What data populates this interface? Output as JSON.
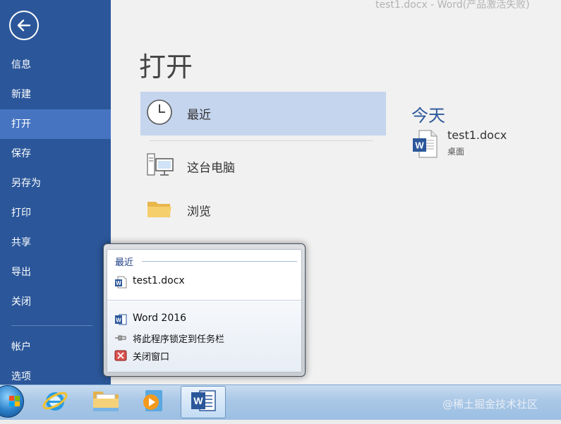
{
  "window": {
    "title": "test1.docx - Word(产品激活失败)"
  },
  "sidebar": {
    "back_icon": "back-arrow-icon",
    "items": [
      {
        "label": "信息"
      },
      {
        "label": "新建"
      },
      {
        "label": "打开",
        "active": true
      },
      {
        "label": "保存"
      },
      {
        "label": "另存为"
      },
      {
        "label": "打印"
      },
      {
        "label": "共享"
      },
      {
        "label": "导出"
      },
      {
        "label": "关闭"
      },
      {
        "label": "帐户"
      },
      {
        "label": "选项"
      }
    ]
  },
  "open_page": {
    "title": "打开",
    "locations": [
      {
        "label": "最近",
        "icon": "clock-icon",
        "active": true
      },
      {
        "label": "这台电脑",
        "icon": "computer-icon"
      },
      {
        "label": "浏览",
        "icon": "folder-icon"
      }
    ],
    "recent": {
      "group_header": "今天",
      "files": [
        {
          "name": "test1.docx",
          "location": "桌面",
          "icon": "word-doc-icon"
        }
      ]
    }
  },
  "jumplist": {
    "header": "最近",
    "recent_items": [
      {
        "label": "test1.docx",
        "icon": "word-doc-icon"
      }
    ],
    "tasks": [
      {
        "label": "Word 2016",
        "icon": "word-app-icon"
      },
      {
        "label": "将此程序锁定到任务栏",
        "icon": "pin-icon"
      },
      {
        "label": "关闭窗口",
        "icon": "close-window-icon"
      }
    ]
  },
  "taskbar": {
    "items": [
      {
        "name": "start-button",
        "icon": "windows-logo-icon"
      },
      {
        "name": "internet-explorer",
        "icon": "internet-explorer-icon"
      },
      {
        "name": "windows-explorer",
        "icon": "file-explorer-icon"
      },
      {
        "name": "media-player",
        "icon": "media-player-icon"
      },
      {
        "name": "word",
        "icon": "word-app-icon",
        "active": true
      }
    ],
    "watermark": "@稀土掘金技术社区"
  },
  "colors": {
    "sidebar": "#2b579a",
    "sidebar_active": "#4674c1",
    "location_active": "#c5d5ee",
    "accent": "#2b579a"
  }
}
